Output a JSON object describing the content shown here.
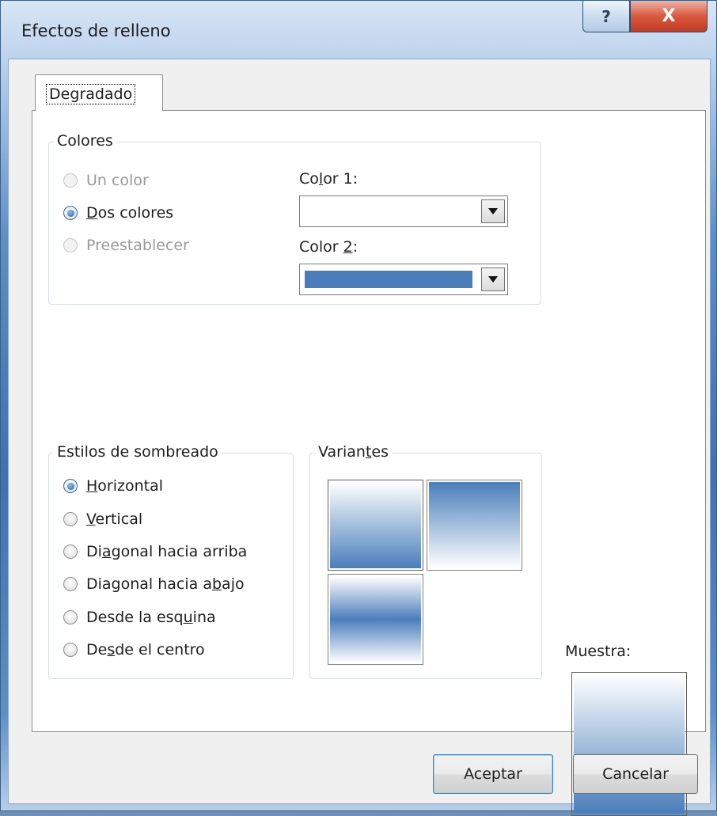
{
  "window": {
    "title": "Efectos de relleno",
    "help_label": "?",
    "close_label": "X"
  },
  "tab": {
    "label": "Degradado"
  },
  "colors_group": {
    "legend": "Colores",
    "options": [
      {
        "label_pre": "",
        "mnemonic": "",
        "label_post": "Un color",
        "selected": false,
        "enabled": false
      },
      {
        "label_pre": "",
        "mnemonic": "D",
        "label_post": "os colores",
        "selected": true,
        "enabled": true
      },
      {
        "label_pre": "",
        "mnemonic": "",
        "label_post": "Preestablecer",
        "selected": false,
        "enabled": false
      }
    ],
    "color1": {
      "label_pre": "Co",
      "mnemonic": "l",
      "label_post": "or 1:",
      "value": "#ffffff"
    },
    "color2": {
      "label_pre": "Color ",
      "mnemonic": "2",
      "label_post": ":",
      "value": "#4a7ebb"
    }
  },
  "shading_group": {
    "legend": "Estilos de sombreado",
    "options": [
      {
        "label_pre": "",
        "mnemonic": "H",
        "label_post": "orizontal",
        "selected": true
      },
      {
        "label_pre": "",
        "mnemonic": "V",
        "label_post": "ertical",
        "selected": false
      },
      {
        "label_pre": "Di",
        "mnemonic": "a",
        "label_post": "gonal hacia arriba",
        "selected": false
      },
      {
        "label_pre": "Diagonal hacia a",
        "mnemonic": "b",
        "label_post": "ajo",
        "selected": false
      },
      {
        "label_pre": "Desde la esq",
        "mnemonic": "u",
        "label_post": "ina",
        "selected": false
      },
      {
        "label_pre": "De",
        "mnemonic": "s",
        "label_post": "de el centro",
        "selected": false
      }
    ]
  },
  "variants_group": {
    "legend_pre": "Varian",
    "legend_mnemonic": "t",
    "legend_post": "es"
  },
  "sample": {
    "label": "Muestra:"
  },
  "buttons": {
    "ok": "Aceptar",
    "cancel": "Cancelar"
  },
  "colors": {
    "accent": "#4a7ebb",
    "white": "#ffffff"
  }
}
